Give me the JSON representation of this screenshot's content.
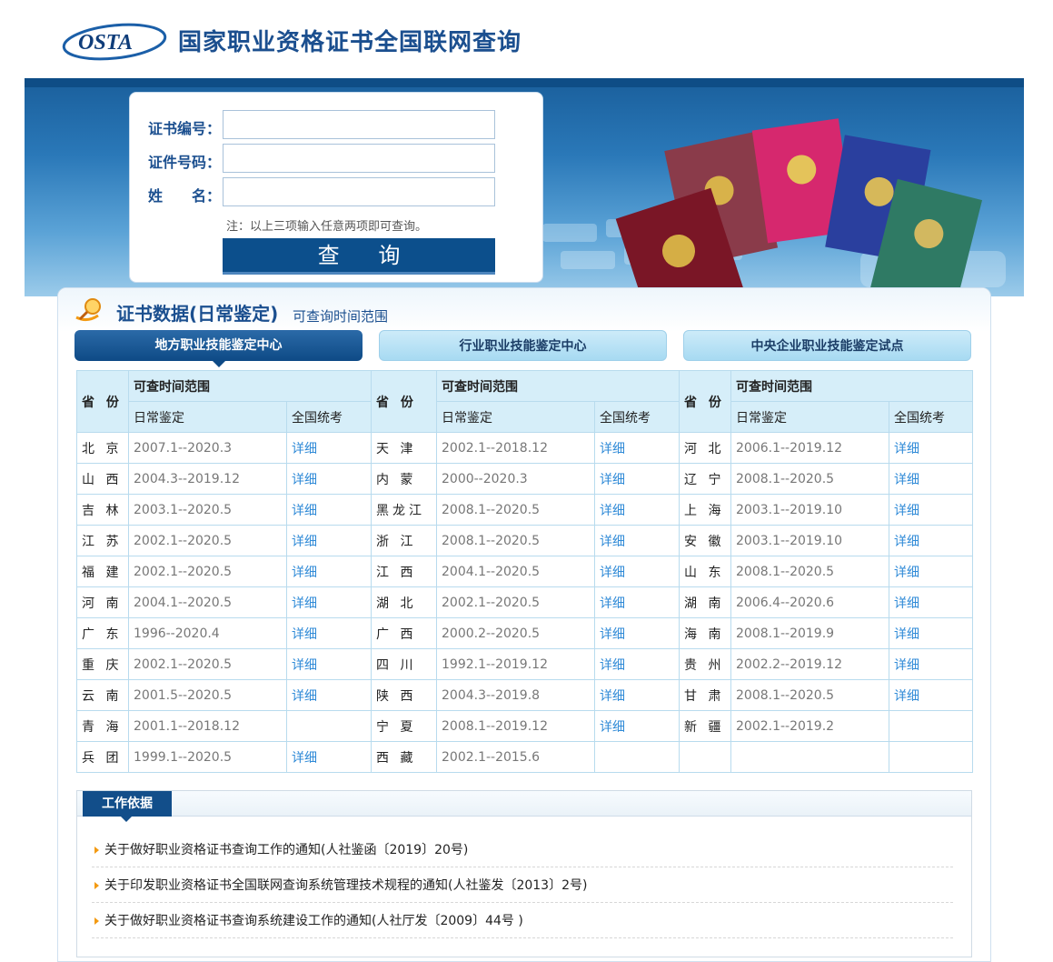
{
  "header": {
    "logo_text": "OSTA",
    "title": "国家职业资格证书全国联网查询"
  },
  "query_form": {
    "cert_no_label": "证书编号：",
    "id_no_label": "证件号码：",
    "name_label": "姓　　名：",
    "cert_no_value": "",
    "id_no_value": "",
    "name_value": "",
    "note": "注：以上三项输入任意两项即可查询。",
    "submit_label": "查 询"
  },
  "section": {
    "title": "证书数据(日常鉴定)",
    "subtitle": "可查询时间范围",
    "tabs": [
      {
        "label": "地方职业技能鉴定中心",
        "active": true
      },
      {
        "label": "行业职业技能鉴定中心",
        "active": false
      },
      {
        "label": "中央企业职业技能鉴定试点",
        "active": false
      }
    ]
  },
  "table": {
    "province_header": "省 份",
    "range_header": "可查时间范围",
    "daily_header": "日常鉴定",
    "national_header": "全国统考",
    "detail_label": "详细",
    "rows": [
      [
        {
          "p": "北 京",
          "r": "2007.1--2020.3",
          "d": "详细"
        },
        {
          "p": "天 津",
          "r": "2002.1--2018.12",
          "d": "详细"
        },
        {
          "p": "河 北",
          "r": "2006.1--2019.12",
          "d": "详细"
        }
      ],
      [
        {
          "p": "山 西",
          "r": "2004.3--2019.12",
          "d": "详细"
        },
        {
          "p": "内 蒙",
          "r": "2000--2020.3",
          "d": "详细"
        },
        {
          "p": "辽 宁",
          "r": "2008.1--2020.5",
          "d": "详细"
        }
      ],
      [
        {
          "p": "吉 林",
          "r": "2003.1--2020.5",
          "d": "详细"
        },
        {
          "p": "黑龙江",
          "r": "2008.1--2020.5",
          "d": "详细"
        },
        {
          "p": "上 海",
          "r": "2003.1--2019.10",
          "d": "详细"
        }
      ],
      [
        {
          "p": "江 苏",
          "r": "2002.1--2020.5",
          "d": "详细"
        },
        {
          "p": "浙 江",
          "r": "2008.1--2020.5",
          "d": "详细"
        },
        {
          "p": "安 徽",
          "r": "2003.1--2019.10",
          "d": "详细"
        }
      ],
      [
        {
          "p": "福 建",
          "r": "2002.1--2020.5",
          "d": "详细"
        },
        {
          "p": "江 西",
          "r": "2004.1--2020.5",
          "d": "详细"
        },
        {
          "p": "山 东",
          "r": "2008.1--2020.5",
          "d": "详细"
        }
      ],
      [
        {
          "p": "河 南",
          "r": "2004.1--2020.5",
          "d": "详细"
        },
        {
          "p": "湖 北",
          "r": "2002.1--2020.5",
          "d": "详细"
        },
        {
          "p": "湖 南",
          "r": "2006.4--2020.6",
          "d": "详细"
        }
      ],
      [
        {
          "p": "广 东",
          "r": "1996--2020.4",
          "d": "详细"
        },
        {
          "p": "广 西",
          "r": "2000.2--2020.5",
          "d": "详细"
        },
        {
          "p": "海 南",
          "r": "2008.1--2019.9",
          "d": "详细"
        }
      ],
      [
        {
          "p": "重 庆",
          "r": "2002.1--2020.5",
          "d": "详细"
        },
        {
          "p": "四 川",
          "r": "1992.1--2019.12",
          "d": "详细"
        },
        {
          "p": "贵 州",
          "r": "2002.2--2019.12",
          "d": "详细"
        }
      ],
      [
        {
          "p": "云 南",
          "r": "2001.5--2020.5",
          "d": "详细"
        },
        {
          "p": "陕 西",
          "r": "2004.3--2019.8",
          "d": "详细"
        },
        {
          "p": "甘 肃",
          "r": "2008.1--2020.5",
          "d": "详细"
        }
      ],
      [
        {
          "p": "青 海",
          "r": "2001.1--2018.12",
          "d": ""
        },
        {
          "p": "宁 夏",
          "r": "2008.1--2019.12",
          "d": "详细"
        },
        {
          "p": "新 疆",
          "r": "2002.1--2019.2",
          "d": ""
        }
      ],
      [
        {
          "p": "兵 团",
          "r": "1999.1--2020.5",
          "d": "详细"
        },
        {
          "p": "西 藏",
          "r": "2002.1--2015.6",
          "d": ""
        },
        {
          "p": "",
          "r": "",
          "d": ""
        }
      ]
    ]
  },
  "basis": {
    "title": "工作依据",
    "items": [
      "关于做好职业资格证书查询工作的通知(人社鉴函〔2019〕20号)",
      "关于印发职业资格证书全国联网查询系统管理技术规程的通知(人社鉴发〔2013〕2号)",
      "关于做好职业资格证书查询系统建设工作的通知(人社厅发〔2009〕44号 )"
    ]
  },
  "colors": {
    "brand_blue": "#1b4f8f",
    "button_blue": "#0c4f8c",
    "link_blue": "#2f8ad7",
    "table_head_bg": "#d6eef9"
  }
}
